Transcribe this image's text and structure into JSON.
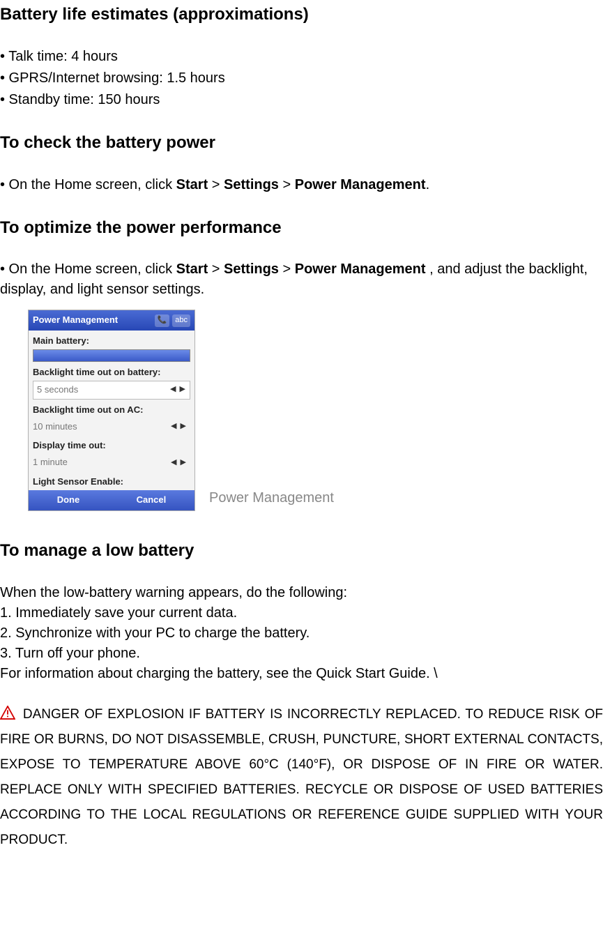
{
  "title": "Battery life estimates (approximations)",
  "bullets": {
    "b1": "• Talk time: 4 hours",
    "b2": "• GPRS/Internet browsing: 1.5 hours",
    "b3": "• Standby time: 150 hours"
  },
  "checkPower": {
    "heading": "To check the battery power",
    "line_pre": "• On the Home screen, click ",
    "start": "Start",
    "gt1": " > ",
    "settings": "Settings",
    "gt2": " > ",
    "pm": "Power Management",
    "line_post": "."
  },
  "optimize": {
    "heading": "To optimize the power performance",
    "line_pre": "• On the Home screen, click ",
    "start": "Start",
    "gt1": " > ",
    "settings": "Settings",
    "gt2": " > ",
    "pm": "Power Management",
    "line_post": " , and adjust the backlight, display, and light sensor settings."
  },
  "screenshot": {
    "title": "Power Management",
    "status_abc": "abc",
    "labels": {
      "main_battery": "Main battery:",
      "backlight_batt": "Backlight time out on battery:",
      "backlight_ac": "Backlight time out on AC:",
      "display_timeout": "Display time out:",
      "light_sensor": "Light Sensor Enable:"
    },
    "values": {
      "backlight_batt": "5 seconds",
      "backlight_ac": "10 minutes",
      "display_timeout": "1 minute"
    },
    "softkeys": {
      "done": "Done",
      "cancel": "Cancel"
    },
    "caption": "Power Management"
  },
  "lowBattery": {
    "heading": "To manage a low battery",
    "intro": "When the low-battery warning appears, do the following:",
    "s1": "1. Immediately save your current data.",
    "s2": "2. Synchronize with your PC to charge the battery.",
    "s3": "3. Turn off your phone.",
    "more": "For information about charging the battery, see the Quick Start Guide. \\"
  },
  "warning": " DANGER OF EXPLOSION IF BATTERY IS INCORRECTLY REPLACED. TO REDUCE RISK OF FIRE OR BURNS, DO NOT DISASSEMBLE, CRUSH, PUNCTURE, SHORT EXTERNAL CONTACTS, EXPOSE TO TEMPERATURE ABOVE 60°C (140°F), OR DISPOSE OF IN FIRE OR WATER. REPLACE ONLY WITH SPECIFIED BATTERIES. RECYCLE OR DISPOSE OF USED BATTERIES ACCORDING TO THE LOCAL REGULATIONS OR REFERENCE GUIDE SUPPLIED WITH YOUR PRODUCT."
}
